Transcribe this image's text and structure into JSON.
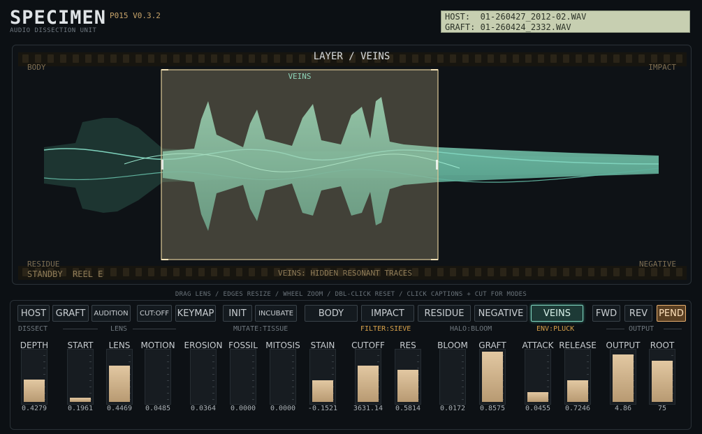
{
  "header": {
    "logo": "SPECIMEN",
    "version": "P015 V0.3.2",
    "subtitle": "AUDIO DISSECTION UNIT",
    "host_file": "HOST:  01-260427_2012-02.WAV",
    "graft_file": "GRAFT: 01-260424_2332.WAV"
  },
  "waveform": {
    "title": "LAYER / VEINS",
    "lens_caption": "VEINS",
    "corner_tl": "BODY",
    "corner_tr": "IMPACT",
    "corner_bl": "RESIDUE",
    "corner_br": "NEGATIVE",
    "status": "STANDBY  REEL E",
    "mode_description": "VEINS: HIDDEN RESONANT TRACES",
    "hint": "DRAG LENS / EDGES RESIZE / WHEEL ZOOM / DBL-CLICK RESET / CLICK CAPTIONS + CUT FOR MODES"
  },
  "buttons": {
    "host": "HOST",
    "graft": "GRAFT",
    "audition": "AUDITION",
    "cut": "CUT:OFF",
    "keymap": "KEYMAP",
    "init": "INIT",
    "incubate": "INCUBATE",
    "body": "BODY",
    "impact": "IMPACT",
    "residue": "RESIDUE",
    "negative": "NEGATIVE",
    "veins": "VEINS",
    "fwd": "FWD",
    "rev": "REV",
    "pend": "PEND"
  },
  "groups": {
    "dissect": "DISSECT",
    "lens": "LENS",
    "mutate": "MUTATE:TISSUE",
    "filter": "FILTER:SIEVE",
    "halo": "HALO:BLOOM",
    "env": "ENV:PLUCK",
    "output": "OUTPUT"
  },
  "knobs": [
    {
      "label": "DEPTH",
      "value": "0.4279",
      "level": 0.43
    },
    {
      "label": "START",
      "value": "0.1961",
      "level": 0.08
    },
    {
      "label": "LENS",
      "value": "0.4469",
      "level": 0.7
    },
    {
      "label": "MOTION",
      "value": "0.0485",
      "level": 0.0
    },
    {
      "label": "EROSION",
      "value": "0.0364",
      "level": 0.0
    },
    {
      "label": "FOSSIL",
      "value": "0.0000",
      "level": 0.0
    },
    {
      "label": "MITOSIS",
      "value": "0.0000",
      "level": 0.0
    },
    {
      "label": "STAIN",
      "value": "-0.1521",
      "level": 0.42
    },
    {
      "label": "CUTOFF",
      "value": "3631.14",
      "level": 0.7
    },
    {
      "label": "RES",
      "value": "0.5814",
      "level": 0.62
    },
    {
      "label": "BLOOM",
      "value": "0.0172",
      "level": 0.0
    },
    {
      "label": "GRAFT",
      "value": "0.8575",
      "level": 0.97
    },
    {
      "label": "ATTACK",
      "value": "0.0455",
      "level": 0.19
    },
    {
      "label": "RELEASE",
      "value": "0.7246",
      "level": 0.42
    },
    {
      "label": "OUTPUT",
      "value": "4.86",
      "level": 0.92
    },
    {
      "label": "ROOT",
      "value": "75",
      "level": 0.8
    }
  ],
  "colors": {
    "accent": "#7fd3bd",
    "amber": "#d8a24a",
    "fill": "#d6bb93"
  }
}
